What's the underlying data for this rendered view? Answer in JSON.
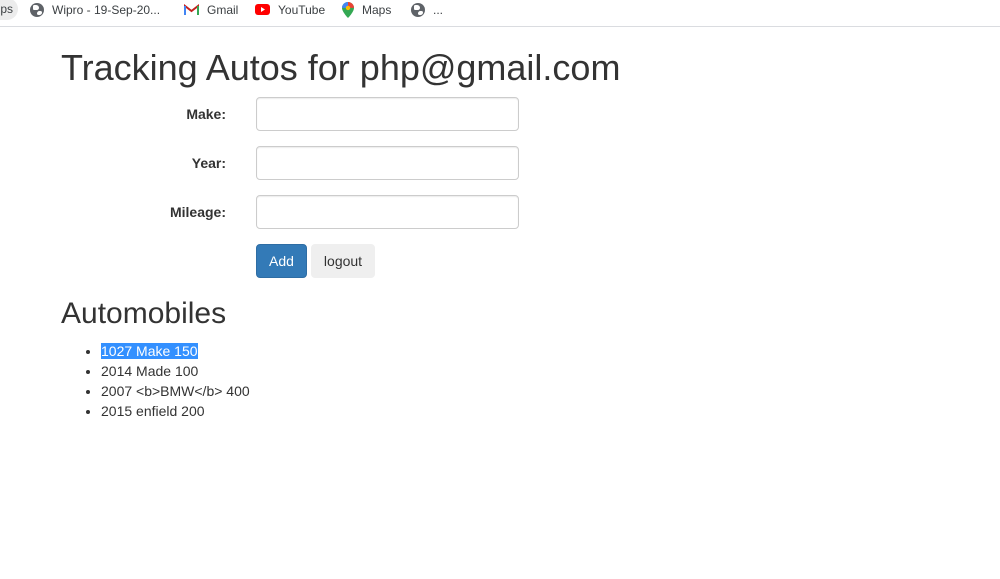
{
  "bookmarks": {
    "apps_label": "ps",
    "items": [
      {
        "label": "Wipro - 19-Sep-20...",
        "icon": "globe-icon"
      },
      {
        "label": "Gmail",
        "icon": "gmail-icon"
      },
      {
        "label": "YouTube",
        "icon": "youtube-icon"
      },
      {
        "label": "Maps",
        "icon": "maps-icon"
      },
      {
        "label": "...",
        "icon": "globe-icon"
      }
    ]
  },
  "page": {
    "title": "Tracking Autos for php@gmail.com"
  },
  "form": {
    "make_label": "Make:",
    "make_value": "",
    "year_label": "Year:",
    "year_value": "",
    "mileage_label": "Mileage:",
    "mileage_value": "",
    "add_label": "Add",
    "logout_label": "logout"
  },
  "automobiles": {
    "heading": "Automobiles",
    "items": [
      "1027 Make 150",
      "2014 Made 100",
      "2007 <b>BMW</b> 400",
      "2015 enfield 200"
    ]
  },
  "colors": {
    "primary_button": "#337ab7",
    "selection_highlight": "#3390ff"
  }
}
